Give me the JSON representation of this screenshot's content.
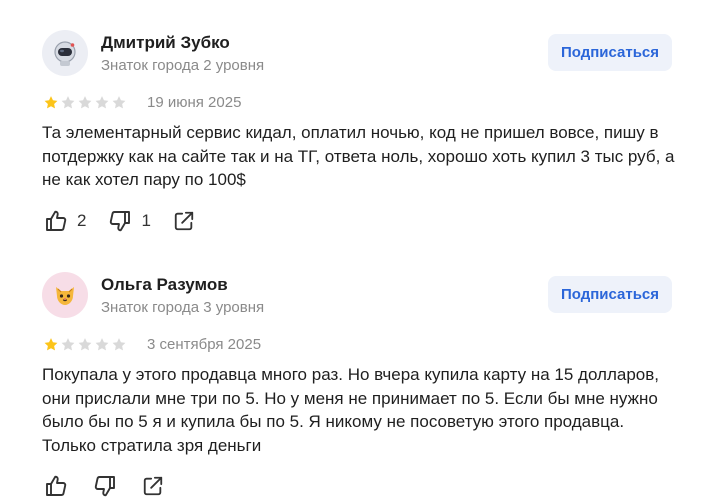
{
  "reviews": [
    {
      "author": "Дмитрий Зубко",
      "level": "Знаток города 2 уровня",
      "avatar_icon": "astronaut-icon",
      "subscribe_label": "Подписаться",
      "rating": 1,
      "rating_max": 5,
      "date": "19 июня 2025",
      "text": "Та элементарный сервис кидал, оплатил ночью, код не пришел вовсе, пишу в потдержку как на сайте так и на ТГ, ответа ноль, хорошо хоть купил 3 тыс руб, а не как хотел пару по 100$",
      "likes": "2",
      "dislikes": "1"
    },
    {
      "author": "Ольга Разумов",
      "level": "Знаток города 3 уровня",
      "avatar_icon": "cat-icon",
      "subscribe_label": "Подписаться",
      "rating": 1,
      "rating_max": 5,
      "date": "3 сентября 2025",
      "text": "Покупала у этого продавца много раз. Но вчера купила карту на 15 долларов, они прислали мне три по 5. Но у меня не принимает по 5. Если бы мне нужно было бы по 5 я и купила бы по 5. Я никому не посоветую этого продавца. Только стратила зря деньги",
      "likes": "",
      "dislikes": ""
    }
  ],
  "colors": {
    "star_filled": "#fcc419",
    "star_empty": "#d9d9d9",
    "accent": "#2b66d9",
    "subscribe_bg": "#eef2fa"
  }
}
